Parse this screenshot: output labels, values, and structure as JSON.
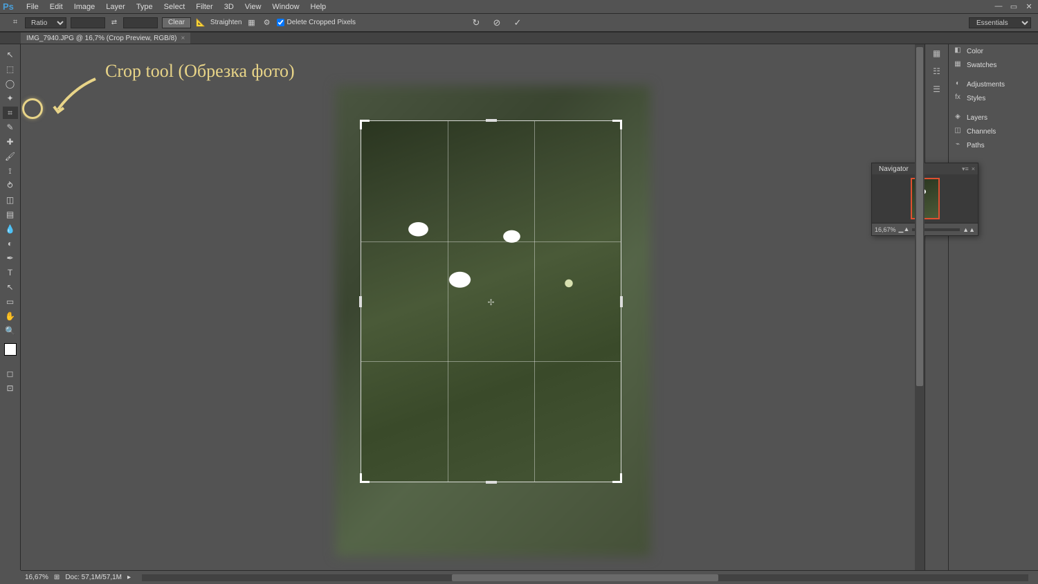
{
  "menu": [
    "File",
    "Edit",
    "Image",
    "Layer",
    "Type",
    "Select",
    "Filter",
    "3D",
    "View",
    "Window",
    "Help"
  ],
  "options": {
    "ratio_label": "Ratio",
    "clear": "Clear",
    "straighten": "Straighten",
    "delete_cropped": "Delete Cropped Pixels"
  },
  "workspace": "Essentials",
  "tab": {
    "title": "IMG_7940.JPG @ 16,7% (Crop Preview, RGB/8)"
  },
  "annotation": {
    "text": "Crop tool (Обрезка фото)"
  },
  "panels": {
    "color": "Color",
    "swatches": "Swatches",
    "adjustments": "Adjustments",
    "styles": "Styles",
    "layers": "Layers",
    "channels": "Channels",
    "paths": "Paths"
  },
  "navigator": {
    "title": "Navigator",
    "zoom": "16,67%"
  },
  "status": {
    "zoom": "16,67%",
    "doc": "Doc: 57,1M/57,1M"
  },
  "tools": [
    "move-tool",
    "marquee-tool",
    "lasso-tool",
    "wand-tool",
    "crop-tool",
    "eyedrop-tool",
    "heal-tool",
    "brush-tool",
    "stamp-tool",
    "history-brush-tool",
    "eraser-tool",
    "gradient-tool",
    "blur-tool",
    "dodge-tool",
    "pen-tool",
    "type-tool",
    "path-tool",
    "shape-tool",
    "hand-tool",
    "zoom-tool"
  ],
  "tool_glyphs": [
    "↖",
    "⬚",
    "◯",
    "✦",
    "⌗",
    "✎",
    "✚",
    "🖌",
    "⟟",
    "⥁",
    "◫",
    "▤",
    "💧",
    "◐",
    "✒",
    "T",
    "↖",
    "▭",
    "✋",
    "🔍"
  ]
}
